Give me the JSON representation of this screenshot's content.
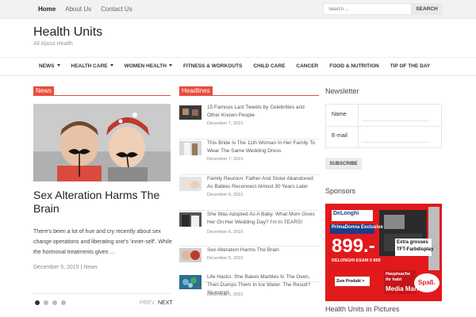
{
  "topnav": {
    "items": [
      {
        "label": "Home",
        "active": true
      },
      {
        "label": "About Us",
        "active": false
      },
      {
        "label": "Contact Us",
        "active": false
      }
    ],
    "search_placeholder": "Search ...",
    "search_button": "SEARCH"
  },
  "header": {
    "title": "Health Units",
    "tagline": "All About Health"
  },
  "mainnav": {
    "items": [
      {
        "label": "NEWS",
        "dropdown": true
      },
      {
        "label": "HEALTH CARE",
        "dropdown": true
      },
      {
        "label": "WOMEN HEALTH",
        "dropdown": true
      },
      {
        "label": "FITNESS & WORKOUTS",
        "dropdown": false
      },
      {
        "label": "CHILD CARE",
        "dropdown": false
      },
      {
        "label": "CANCER",
        "dropdown": false
      },
      {
        "label": "FOOD & NUTRITION",
        "dropdown": false
      },
      {
        "label": "TIP OF THE DAY",
        "dropdown": false
      }
    ]
  },
  "news": {
    "section_label": "News",
    "title": "Sex Alteration Harms The Brain",
    "excerpt": "There's been a lot of hue and cry recently about sex change operations and liberating one's 'inner-self'. While the hormonal treatments given ...",
    "date": "December 5, 2015",
    "separator": "|",
    "category": "News",
    "prev": "PREV",
    "next": "NEXT",
    "active_slide": 1,
    "slide_count": 4
  },
  "headlines": {
    "section_label": "Headlines",
    "items": [
      {
        "title": "15 Famous Last Tweets by Celebrities and Other Known People",
        "date": "December 7, 2015"
      },
      {
        "title": "This Bride Is The 11th Woman In Her Family To Wear The Same Wedding Dress",
        "date": "December 7, 2015"
      },
      {
        "title": "Family Reunion: Father And Sister Abandoned As Babies Reconnect Almost 30 Years Later",
        "date": "December 6, 2015"
      },
      {
        "title": "She Was Adopted As A Baby. What Mom Gives Her On Her Wedding Day? I'm In TEARS!",
        "date": "December 6, 2015"
      },
      {
        "title": "Sex Alteration Harms The Brain",
        "date": "December 5, 2015"
      },
      {
        "title": "Life Hacks: She Bakes Marbles In The Oven, Then Dumps Them In Ice Water. The Result? Stunning!",
        "date": "December 5, 2015"
      }
    ]
  },
  "sidebar": {
    "newsletter_title": "Newsletter",
    "name_label": "Name",
    "email_label": "E-mail",
    "subscribe": "SUBSCRIBE",
    "sponsors_title": "Sponsors",
    "pictures_title": "Health Units in Pictures",
    "ad": {
      "price": "899.-",
      "brand": "Media Markt",
      "product": "DELONGHI ESAM 6 850",
      "product_sub": "PrimaDonna Exclusive",
      "promo_1": "Extra grosses",
      "promo_2": "TFT-Farbdisplay",
      "link": "Zum Produkt >",
      "brand_logo": "DeLonghi",
      "slogan_1": "Hauptsache",
      "slogan_2": "ihr habt",
      "spass": "Spaß."
    }
  },
  "colors": {
    "accent": "#e74c3c",
    "ad_red": "#e2191b"
  }
}
